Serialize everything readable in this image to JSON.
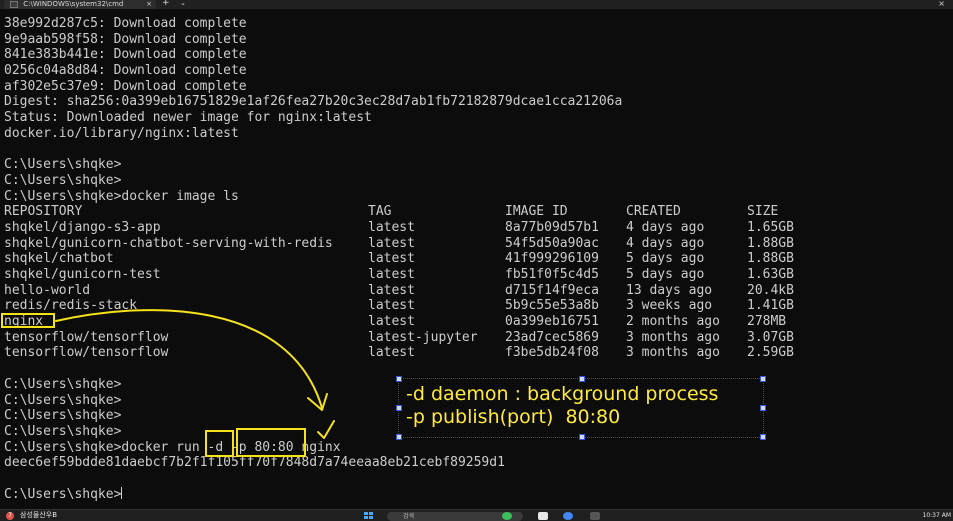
{
  "window": {
    "tab_title": "C:\\WINDOWS\\system32\\cmd",
    "tab_close": "×",
    "new_tab": "+",
    "dropdown": "⌄",
    "close": "×"
  },
  "terminal": {
    "pull_lines": [
      "38e992d287c5: Download complete",
      "9e9aab598f58: Download complete",
      "841e383b441e: Download complete",
      "0256c04a8d84: Download complete",
      "af302e5c37e9: Download complete",
      "Digest: sha256:0a399eb16751829e1af26fea27b20c3ec28d7ab1fb72182879dcae1cca21206a",
      "Status: Downloaded newer image for nginx:latest",
      "docker.io/library/nginx:latest"
    ],
    "prompts_1": [
      "C:\\Users\\shqke>",
      "C:\\Users\\shqke>",
      "C:\\Users\\shqke>docker image ls"
    ],
    "table_headers": [
      "REPOSITORY",
      "TAG",
      "IMAGE ID",
      "CREATED",
      "SIZE"
    ],
    "table_rows": [
      [
        "shqkel/django-s3-app",
        "latest",
        "8a77b09d57b1",
        "4 days ago",
        "1.65GB"
      ],
      [
        "shqkel/gunicorn-chatbot-serving-with-redis",
        "latest",
        "54f5d50a90ac",
        "4 days ago",
        "1.88GB"
      ],
      [
        "shqkel/chatbot",
        "latest",
        "41f999296109",
        "5 days ago",
        "1.88GB"
      ],
      [
        "shqkel/gunicorn-test",
        "latest",
        "fb51f0f5c4d5",
        "5 days ago",
        "1.63GB"
      ],
      [
        "hello-world",
        "latest",
        "d715f14f9eca",
        "13 days ago",
        "20.4kB"
      ],
      [
        "redis/redis-stack",
        "latest",
        "5b9c55e53a8b",
        "3 weeks ago",
        "1.41GB"
      ],
      [
        "nginx",
        "latest",
        "0a399eb16751",
        "2 months ago",
        "278MB"
      ],
      [
        "tensorflow/tensorflow",
        "latest-jupyter",
        "23ad7cec5869",
        "3 months ago",
        "3.07GB"
      ],
      [
        "tensorflow/tensorflow",
        "latest",
        "f3be5db24f08",
        "3 months ago",
        "2.59GB"
      ]
    ],
    "prompts_2": [
      "C:\\Users\\shqke>",
      "C:\\Users\\shqke>",
      "C:\\Users\\shqke>",
      "C:\\Users\\shqke>",
      "C:\\Users\\shqke>docker run -d -p 80:80 nginx",
      "deec6ef59bdde81daebcf7b2f1f105ff70f7848d7a74eeaa8eb21cebf89259d1"
    ],
    "final_prompt": "C:\\Users\\shqke>"
  },
  "annotation": {
    "line1": "-d daemon : background process",
    "line2": "-p publish(port)  80:80",
    "ink_color": "#f5e21a"
  },
  "taskbar": {
    "weather_badge": "7",
    "weather_text": "삼성물산우B",
    "search_placeholder": "검색",
    "clock": "10:37 AM"
  }
}
